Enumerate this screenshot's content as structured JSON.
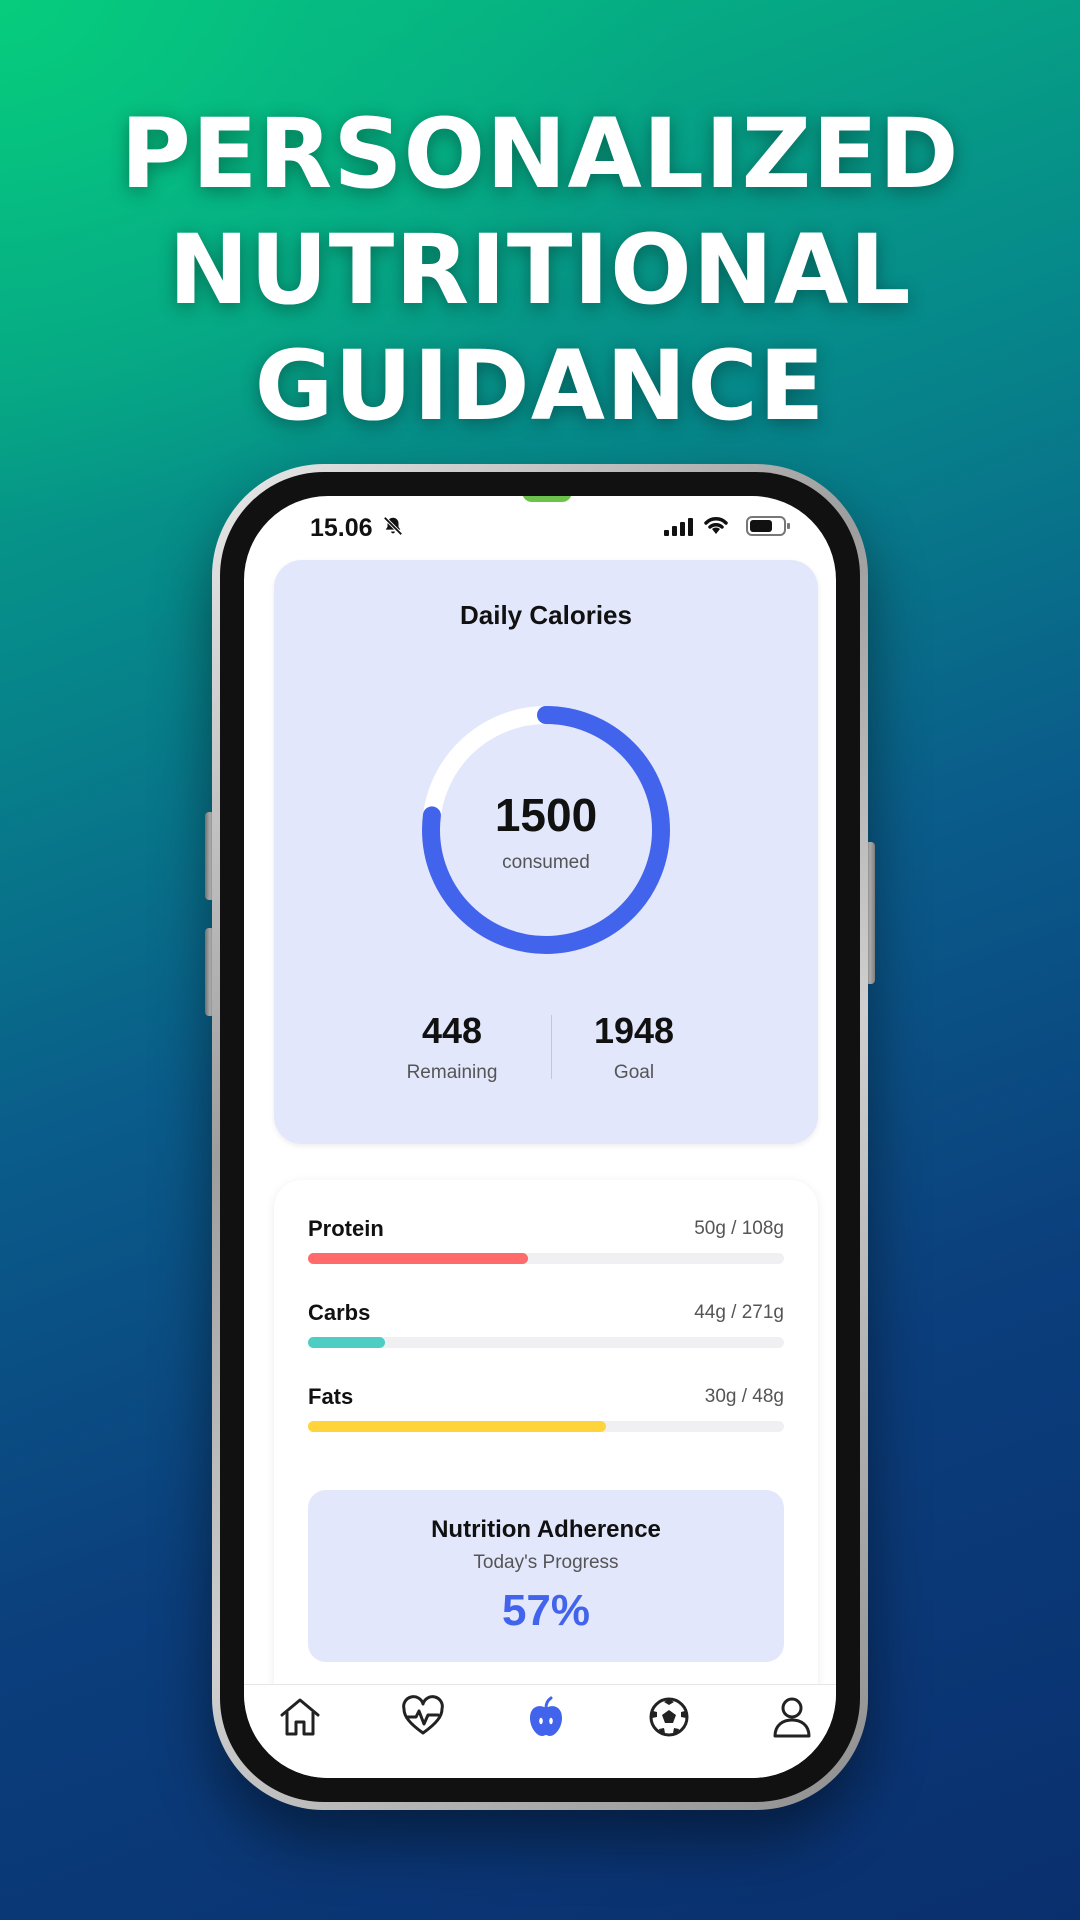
{
  "headline": {
    "line1": "PERSONALIZED",
    "line2": "NUTRITIONAL GUIDANCE"
  },
  "status_bar": {
    "time": "15.06",
    "icons": [
      "bell-slash-icon",
      "signal-icon",
      "wifi-icon",
      "battery-icon"
    ]
  },
  "calories": {
    "title": "Daily Calories",
    "consumed_value": "1500",
    "consumed_label": "consumed",
    "progress_fraction": 0.77,
    "remaining_value": "448",
    "remaining_label": "Remaining",
    "goal_value": "1948",
    "goal_label": "Goal",
    "ring_color": "#4263eb"
  },
  "macros": [
    {
      "name": "Protein",
      "amount": "50g / 108g",
      "fraction": 0.463,
      "color": "#ff6b6b"
    },
    {
      "name": "Carbs",
      "amount": "44g / 271g",
      "fraction": 0.162,
      "color": "#4ecdc4"
    },
    {
      "name": "Fats",
      "amount": "30g / 48g",
      "fraction": 0.625,
      "color": "#ffd43b"
    }
  ],
  "adherence": {
    "title": "Nutrition Adherence",
    "subtitle": "Today's Progress",
    "value": "57%",
    "color": "#4263eb"
  },
  "tabbar": {
    "items": [
      {
        "icon": "home-icon",
        "active": false
      },
      {
        "icon": "heart-pulse-icon",
        "active": false
      },
      {
        "icon": "apple-icon",
        "active": true
      },
      {
        "icon": "soccer-ball-icon",
        "active": false
      },
      {
        "icon": "profile-icon",
        "active": false
      }
    ],
    "active_color": "#4263eb"
  }
}
